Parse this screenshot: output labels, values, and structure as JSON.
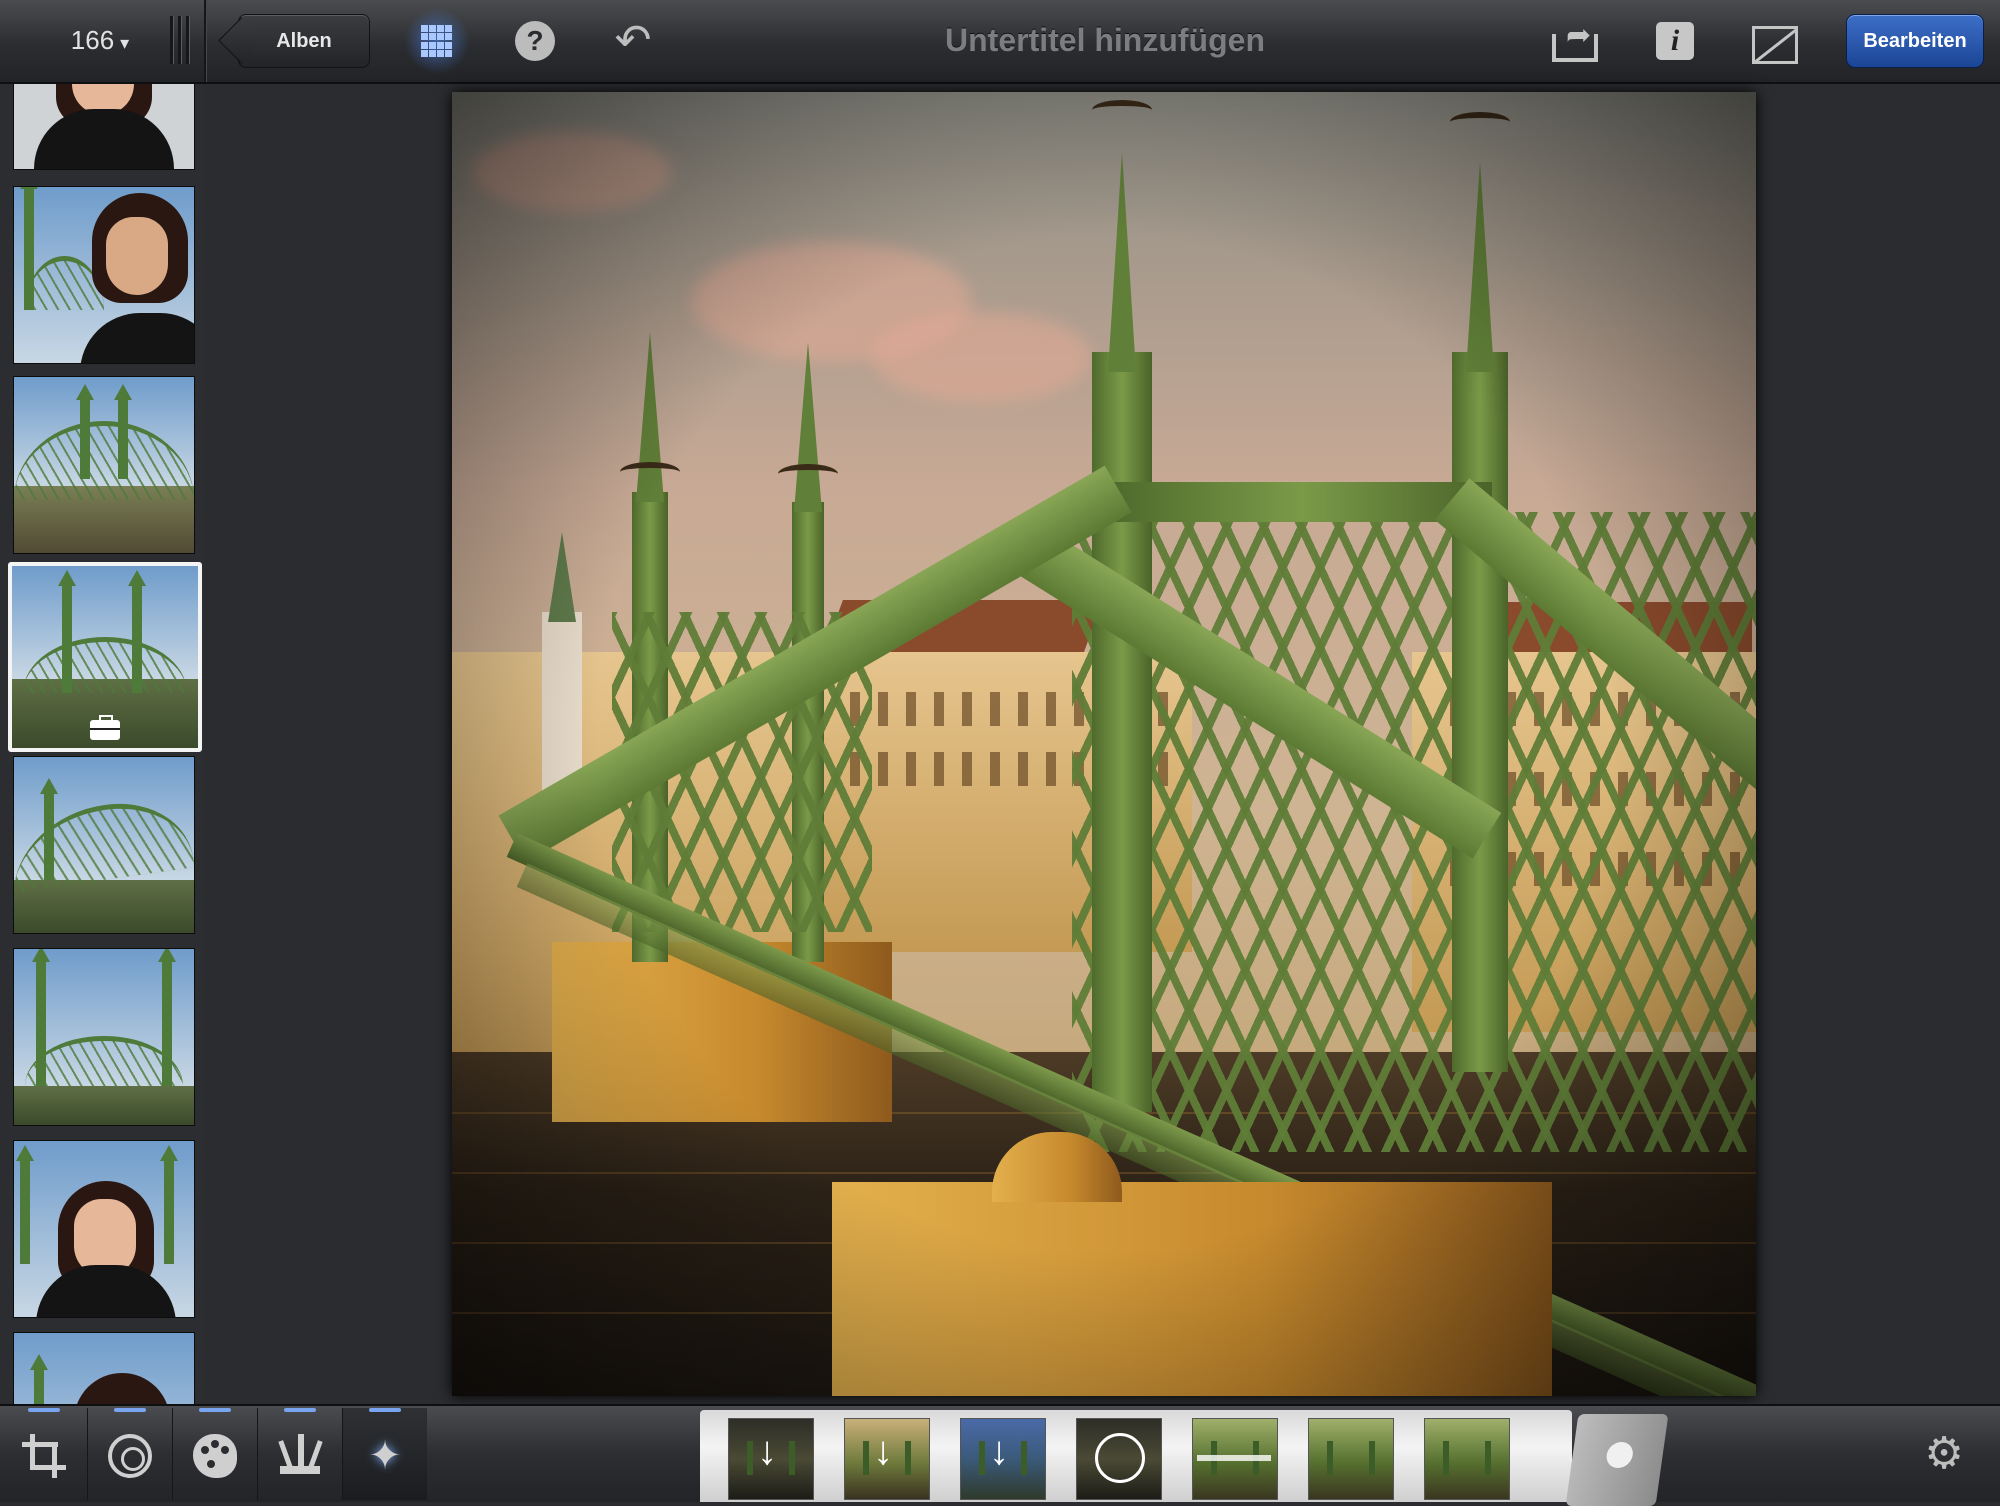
{
  "header": {
    "photo_count": "166",
    "count_caret": "▾",
    "back_label": "Alben",
    "title": "Untertitel hinzufügen",
    "edit_label": "Bearbeiten"
  },
  "icons": {
    "grid": "grid-icon",
    "help": "help-icon",
    "help_glyph": "?",
    "undo": "undo-icon",
    "undo_glyph": "↶",
    "share": "share-icon",
    "share_glyph": "➦",
    "info": "info-icon",
    "info_glyph": "i",
    "compare": "compare-icon",
    "settings_glyph": "⚙",
    "effects_glyph": "✦"
  },
  "sidebar": {
    "thumbnails": [
      {
        "subject": "portrait",
        "selected": false
      },
      {
        "subject": "portrait-bridge",
        "selected": false
      },
      {
        "subject": "bridge-deck",
        "selected": false
      },
      {
        "subject": "bridge",
        "selected": true,
        "badge": "toolbox-icon"
      },
      {
        "subject": "bridge-angle",
        "selected": false
      },
      {
        "subject": "bridge-front",
        "selected": false
      },
      {
        "subject": "portrait-bridge",
        "selected": false
      },
      {
        "subject": "portrait",
        "selected": false
      }
    ]
  },
  "bottom": {
    "tools": [
      "crop-tool",
      "exposure-tool",
      "color-tool",
      "brush-tool",
      "effects-tool"
    ],
    "active_tool": "effects-tool",
    "accent": "#79a4f0",
    "filters": [
      "filter-preset-1",
      "filter-preset-2",
      "filter-preset-3",
      "filter-preset-4",
      "filter-preset-5",
      "filter-preset-6",
      "filter-preset-7"
    ]
  },
  "colors": {
    "edit_button": "#2a5bb3",
    "toolbar": "#2b2d31"
  }
}
